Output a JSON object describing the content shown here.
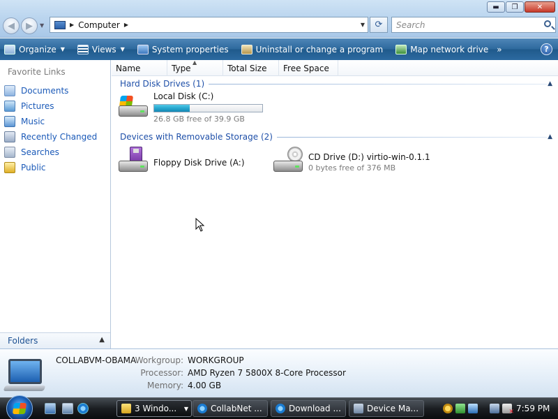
{
  "window": {
    "controls": {
      "minimize": "▬",
      "maximize": "❐",
      "close": "✕"
    }
  },
  "address": {
    "location": "Computer"
  },
  "search": {
    "placeholder": "Search"
  },
  "toolbar": {
    "organize": "Organize",
    "views": "Views",
    "system_properties": "System properties",
    "uninstall": "Uninstall or change a program",
    "map_drive": "Map network drive",
    "more": "»",
    "help": "?"
  },
  "sidebar": {
    "title": "Favorite Links",
    "items": [
      {
        "label": "Documents",
        "icon": "documents-icon"
      },
      {
        "label": "Pictures",
        "icon": "pictures-icon"
      },
      {
        "label": "Music",
        "icon": "music-icon"
      },
      {
        "label": "Recently Changed",
        "icon": "recently-changed-icon"
      },
      {
        "label": "Searches",
        "icon": "searches-icon"
      },
      {
        "label": "Public",
        "icon": "public-folder-icon"
      }
    ],
    "folders_label": "Folders"
  },
  "columns": [
    "Name",
    "Type",
    "Total Size",
    "Free Space"
  ],
  "groups": {
    "hard_disks": {
      "label": "Hard Disk Drives (1)",
      "items": [
        {
          "name": "Local Disk (C:)",
          "free_text": "26.8 GB free of 39.9 GB",
          "used_fraction": 0.328
        }
      ]
    },
    "removable": {
      "label": "Devices with Removable Storage (2)",
      "items": [
        {
          "name": "Floppy Disk Drive (A:)"
        },
        {
          "name": "CD Drive (D:) virtio-win-0.1.1",
          "free_text": "0 bytes free of 376 MB"
        }
      ]
    }
  },
  "details": {
    "computer_name": "COLLABVM-OBAMA",
    "workgroup_label": "Workgroup:",
    "workgroup": "WORKGROUP",
    "processor_label": "Processor:",
    "processor": "AMD Ryzen 7 5800X 8-Core Processor",
    "memory_label": "Memory:",
    "memory": "4.00 GB"
  },
  "taskbar": {
    "tasks": [
      {
        "label": "3 Windo...",
        "icon": "folder-icon"
      },
      {
        "label": "CollabNet ...",
        "icon": "internet-explorer-icon"
      },
      {
        "label": "Download ...",
        "icon": "internet-explorer-icon"
      },
      {
        "label": "Device Ma...",
        "icon": "device-manager-icon"
      }
    ],
    "clock": "7:59 PM"
  }
}
